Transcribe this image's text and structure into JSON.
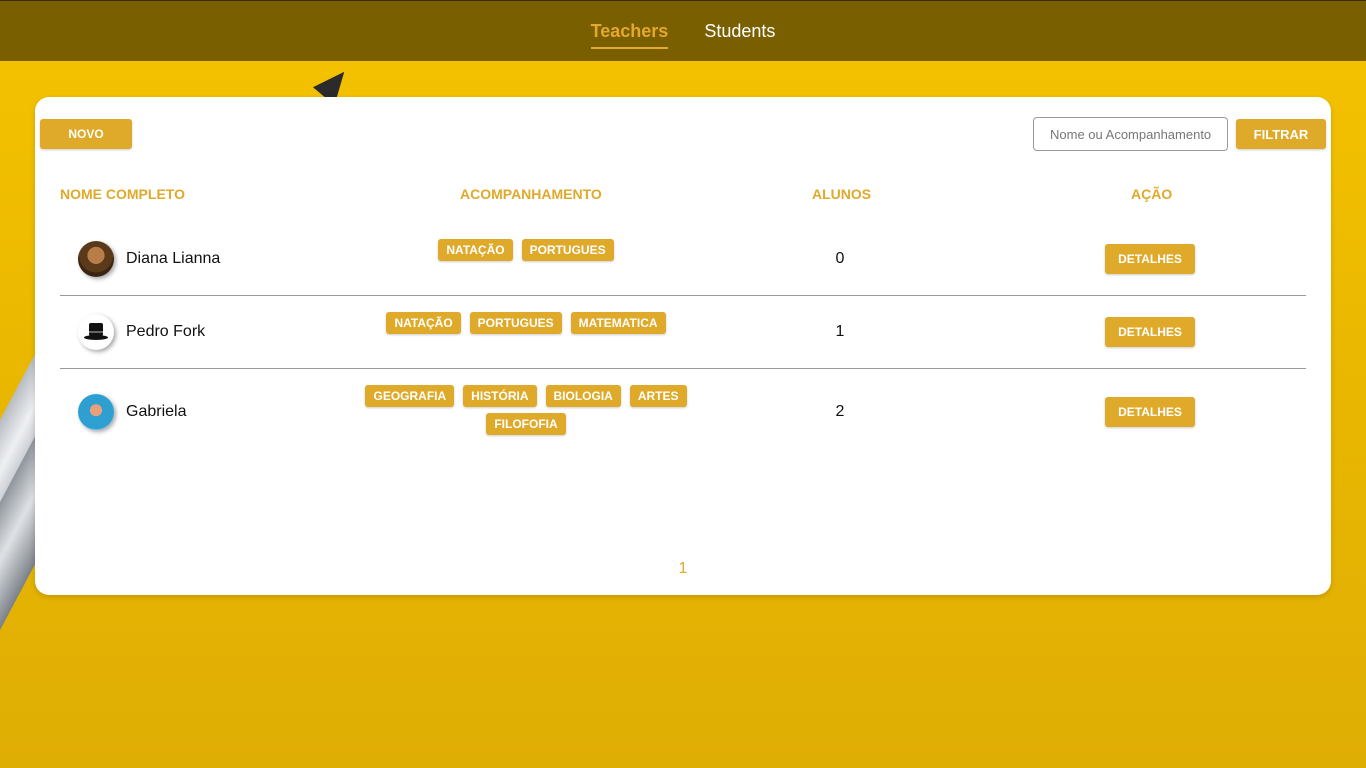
{
  "nav": {
    "items": [
      {
        "label": "Teachers",
        "active": true
      },
      {
        "label": "Students",
        "active": false
      }
    ]
  },
  "toolbar": {
    "new_label": "NOVO",
    "filter_placeholder": "Nome ou Acompanhamento",
    "filter_value": "",
    "filter_button_label": "FILTRAR"
  },
  "table": {
    "headers": {
      "name": "NOME COMPLETO",
      "tracking": "ACOMPANHAMENTO",
      "students": "ALUNOS",
      "action": "AÇÃO"
    },
    "rows": [
      {
        "name": "Diana Lianna",
        "avatar": "woman-portrait-avatar",
        "tags": [
          "NATAÇÃO",
          "PORTUGUES"
        ],
        "students": "0",
        "action_label": "DETALHES"
      },
      {
        "name": "Pedro Fork",
        "avatar": "magic-hat-avatar",
        "tags": [
          "NATAÇÃO",
          "PORTUGUES",
          "MATEMATICA"
        ],
        "students": "1",
        "action_label": "DETALHES"
      },
      {
        "name": "Gabriela",
        "avatar": "cartoon-woman-avatar",
        "tags": [
          "GEOGRAFIA",
          "HISTÓRIA",
          "BIOLOGIA",
          "ARTES",
          "FILOFOFIA"
        ],
        "students": "2",
        "action_label": "DETALHES"
      }
    ]
  },
  "pagination": {
    "current_page": "1"
  },
  "colors": {
    "accent": "#dfa92a",
    "topbar": "#7a5f00",
    "background": "#f6c300"
  }
}
